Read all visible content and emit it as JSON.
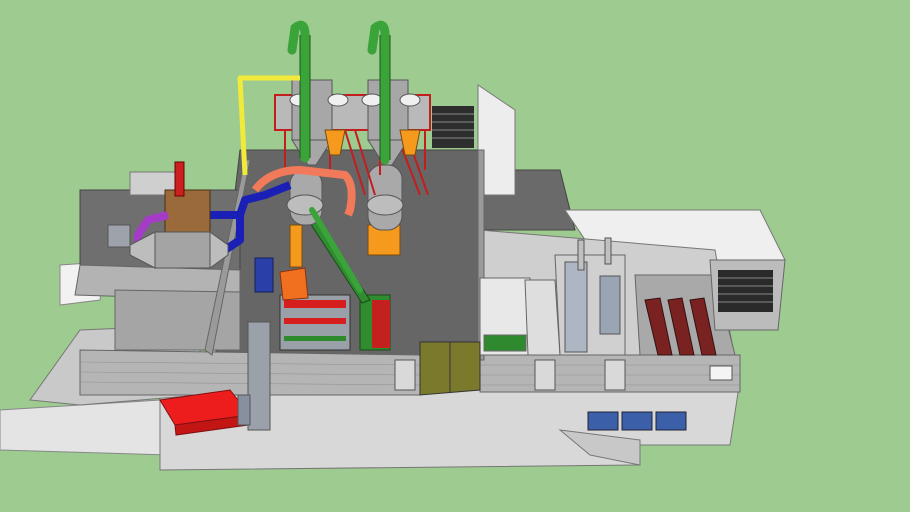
{
  "scene": {
    "background_color": "#9ecb8f",
    "colors": {
      "wall": "#b9b9b9",
      "wall_dark": "#8d8d8d",
      "floor": "#6e6e6e",
      "slab": "#dcdcdc",
      "duct_blue": "#1a1fb5",
      "duct_purple": "#a53cc8",
      "pipe_green": "#3aa33a",
      "pipe_yellow": "#f2ea3a",
      "pipe_salmon": "#f07a5a",
      "hopper_orange": "#f59a1c",
      "cyclone_gray": "#a9a9a9",
      "frame_red": "#d52020",
      "trailer_red": "#ee1d1d",
      "door_olive": "#7a7a2a",
      "bin_blue": "#3b5fa8",
      "chimney_red": "#cc1f1f",
      "burner_brown": "#9a6a3a"
    }
  }
}
